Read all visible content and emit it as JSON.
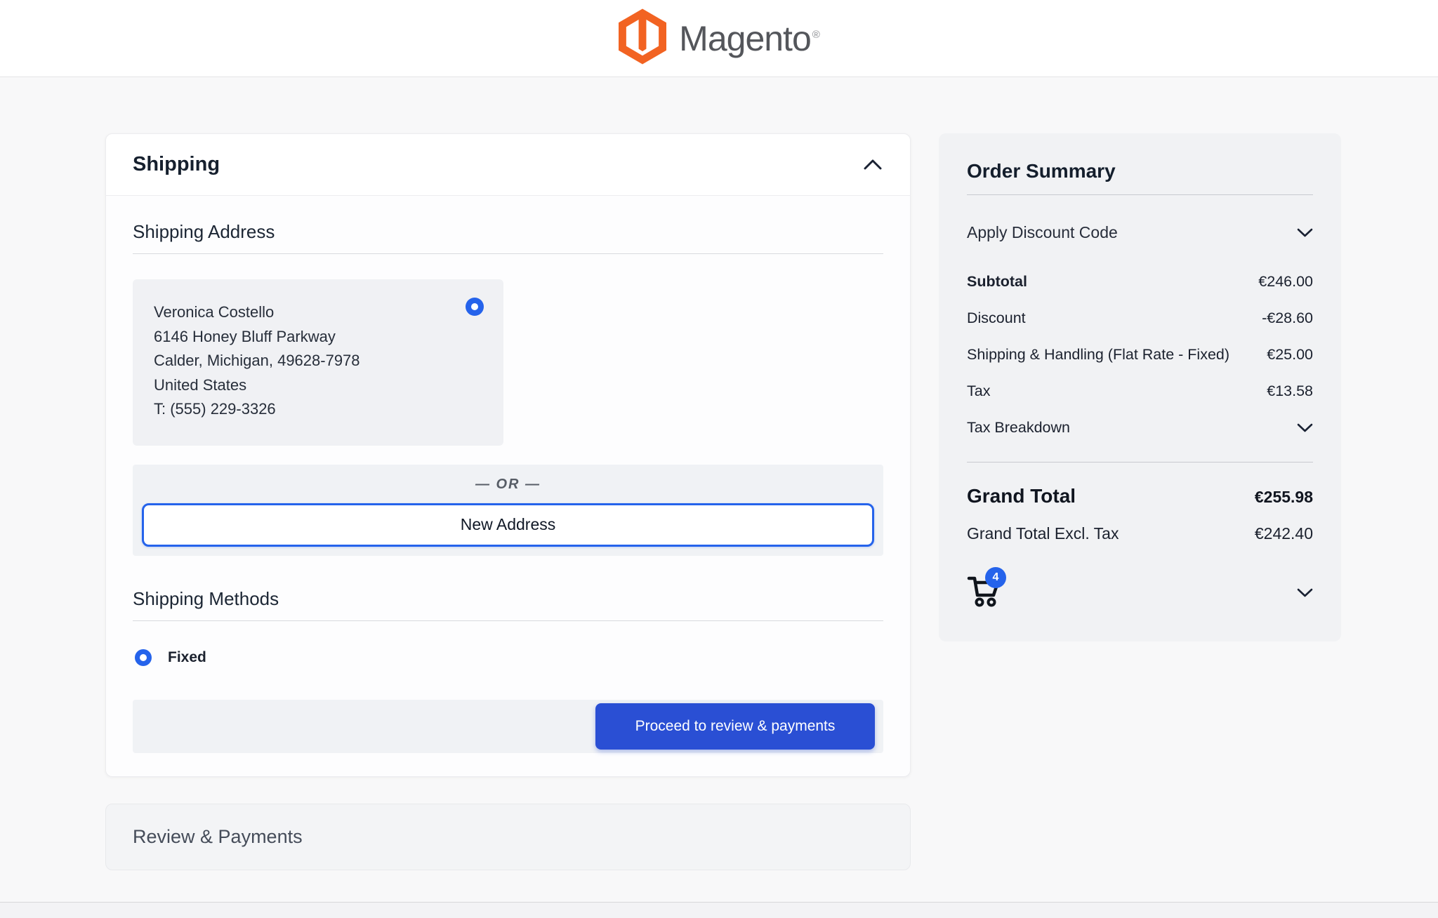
{
  "header": {
    "logo_text": "Magento",
    "logo_reg": "®"
  },
  "shipping": {
    "title": "Shipping",
    "address_section_title": "Shipping Address",
    "address": {
      "name": "Veronica Costello",
      "street": "6146 Honey Bluff Parkway",
      "city_line": "Calder, Michigan, 49628-7978",
      "country": "United States",
      "phone": "T: (555) 229-3326"
    },
    "or_divider": "— OR —",
    "new_address_button": "New Address",
    "methods_title": "Shipping Methods",
    "method_fixed_label": "Fixed",
    "proceed_button": "Proceed to review & payments"
  },
  "review_payments": {
    "title": "Review & Payments"
  },
  "order_summary": {
    "title": "Order Summary",
    "discount_toggle_label": "Apply Discount Code",
    "rows": [
      {
        "label": "Subtotal",
        "value": "€246.00"
      },
      {
        "label": "Discount",
        "value": "-€28.60"
      },
      {
        "label": "Shipping & Handling (Flat Rate - Fixed)",
        "value": "€25.00"
      },
      {
        "label": "Tax",
        "value": "€13.58"
      }
    ],
    "tax_breakdown_label": "Tax Breakdown",
    "grand_total_label": "Grand Total",
    "grand_total_value": "€255.98",
    "grand_total_excl_label": "Grand Total Excl. Tax",
    "grand_total_excl_value": "€242.40",
    "cart_count": "4"
  },
  "icons": {
    "shipping_collapse": "chevron-up",
    "discount_toggle": "chevron-down",
    "tax_breakdown_toggle": "chevron-down",
    "cart_items_toggle": "chevron-down",
    "cart": "shopping-cart"
  },
  "colors": {
    "logo_orange": "#f26322",
    "radio_blue": "#2563eb",
    "button_blue": "#2a4fd4"
  }
}
